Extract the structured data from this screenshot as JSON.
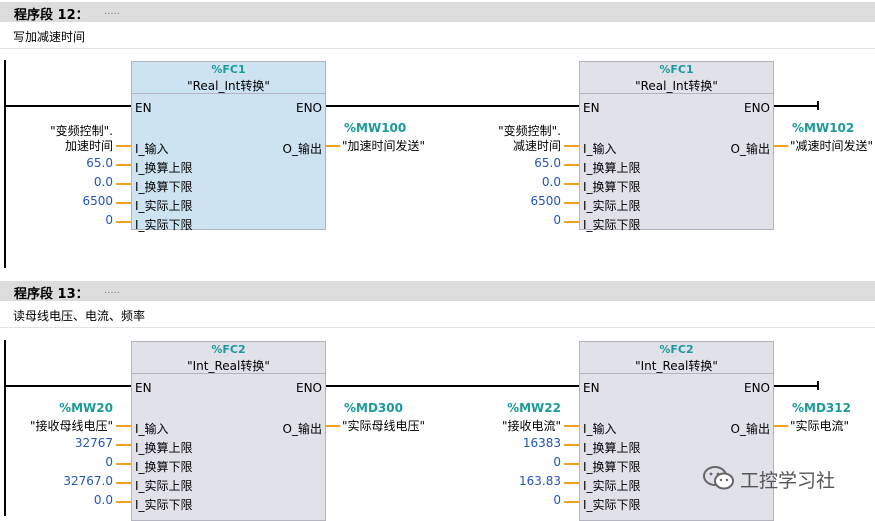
{
  "segments": [
    {
      "title": "程序段 12：",
      "dots": ".....",
      "comment": "写加减速时间",
      "blocks": [
        {
          "address": "%FC1",
          "name": "\"Real_Int转换\"",
          "en": "EN",
          "eno": "ENO",
          "in_pins": [
            "I_输入",
            "I_换算上限",
            "I_换算下限",
            "I_实际上限",
            "I_实际下限"
          ],
          "out_pin": "O_输出",
          "input_var_line1": "\"变频控制\".",
          "input_var_line2": "加速时间",
          "params": [
            "65.0",
            "0.0",
            "6500",
            "0"
          ],
          "out_addr": "%MW100",
          "out_var": "\"加速时间发送\""
        },
        {
          "address": "%FC1",
          "name": "\"Real_Int转换\"",
          "en": "EN",
          "eno": "ENO",
          "in_pins": [
            "I_输入",
            "I_换算上限",
            "I_换算下限",
            "I_实际上限",
            "I_实际下限"
          ],
          "out_pin": "O_输出",
          "input_var_line1": "\"变频控制\".",
          "input_var_line2": "减速时间",
          "params": [
            "65.0",
            "0.0",
            "6500",
            "0"
          ],
          "out_addr": "%MW102",
          "out_var": "\"减速时间发送\""
        }
      ]
    },
    {
      "title": "程序段 13：",
      "dots": ".....",
      "comment": "读母线电压、电流、频率",
      "blocks": [
        {
          "address": "%FC2",
          "name": "\"Int_Real转换\"",
          "en": "EN",
          "eno": "ENO",
          "in_pins": [
            "I_输入",
            "I_换算上限",
            "I_换算下限",
            "I_实际上限",
            "I_实际下限"
          ],
          "out_pin": "O_输出",
          "input_addr": "%MW20",
          "input_var": "\"接收母线电压\"",
          "params": [
            "32767",
            "0",
            "32767.0",
            "0.0"
          ],
          "out_addr": "%MD300",
          "out_var": "\"实际母线电压\""
        },
        {
          "address": "%FC2",
          "name": "\"Int_Real转换\"",
          "en": "EN",
          "eno": "ENO",
          "in_pins": [
            "I_输入",
            "I_换算上限",
            "I_换算下限",
            "I_实际上限",
            "I_实际下限"
          ],
          "out_pin": "O_输出",
          "input_addr": "%MW22",
          "input_var": "\"接收电流\"",
          "params": [
            "16383",
            "0",
            "163.83",
            "0"
          ],
          "out_addr": "%MD312",
          "out_var": "\"实际电流\""
        }
      ]
    }
  ],
  "watermark": {
    "icon": "wechat-icon",
    "text": "工控学习社"
  },
  "colors": {
    "segment_header": "#dcdcdc",
    "block_selected": "#cde3f2",
    "block": "#e1e1e9",
    "wire": "#f0a020",
    "address": "#1c9a9a",
    "constant": "#2456b3"
  }
}
